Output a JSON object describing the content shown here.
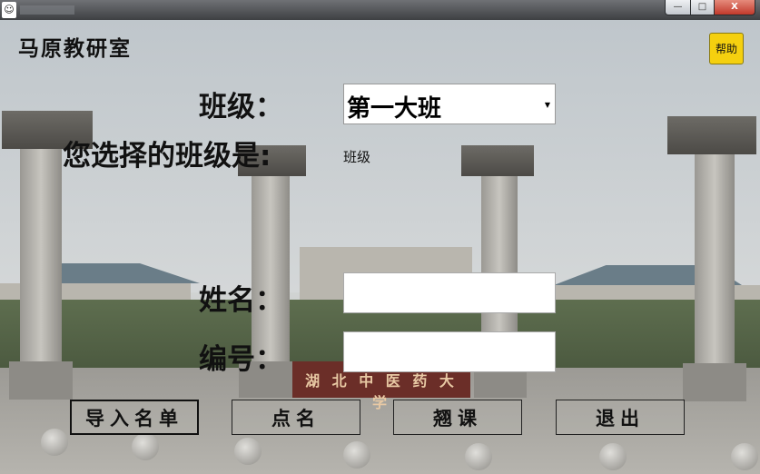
{
  "window": {
    "title_icon": "app-icon",
    "controls": {
      "minimize": "—",
      "maximize": "□",
      "close": "X"
    }
  },
  "app": {
    "lab_title": "马原教研室",
    "help_label": "帮助"
  },
  "form": {
    "class_label": "班级：",
    "class_selected": "第一大班",
    "chosen_label": "您选择的班级是:",
    "chosen_value": "班级",
    "name_label": "姓名：",
    "name_value": "",
    "id_label": "编号：",
    "id_value": ""
  },
  "actions": {
    "import": "导入名单",
    "rollcall": "点名",
    "skip": "翘课",
    "exit": "退出"
  },
  "background": {
    "gate_text": "湖 北 中 医 药 大 学"
  }
}
